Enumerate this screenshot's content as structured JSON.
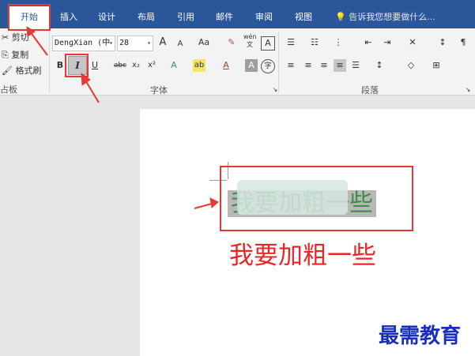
{
  "tabs": [
    {
      "label": "开始"
    },
    {
      "label": "插入"
    },
    {
      "label": "设计"
    },
    {
      "label": "布局"
    },
    {
      "label": "引用"
    },
    {
      "label": "邮件"
    },
    {
      "label": "审阅"
    },
    {
      "label": "视图"
    }
  ],
  "tell_me": "告诉我您想要做什么...",
  "clipboard": {
    "cut": "剪切",
    "copy": "复制",
    "format_painter": "格式刷",
    "group": "占板"
  },
  "font": {
    "name": "DengXian (中",
    "size": "28",
    "group": "字体",
    "grow": "A",
    "shrink": "A",
    "change_case": "Aa",
    "clear": "✎",
    "phonetic": "wén\n文",
    "border": "A",
    "bold": "B",
    "italic": "I",
    "underline": "U",
    "strikethrough": "abc",
    "subscript": "x₂",
    "superscript": "x²",
    "effects": "A",
    "highlight": "ab",
    "font_color": "A",
    "shading": "A",
    "enclose": "字"
  },
  "paragraph": {
    "group": "段落"
  },
  "document": {
    "selected_text": "我要加粗一些",
    "result_text": "我要加粗一些"
  },
  "watermark": "最需教育",
  "colors": {
    "accent": "#2b579a",
    "highlight_red": "#e53935",
    "text_green": "#3e8f4b",
    "text_red": "#e8262a"
  }
}
